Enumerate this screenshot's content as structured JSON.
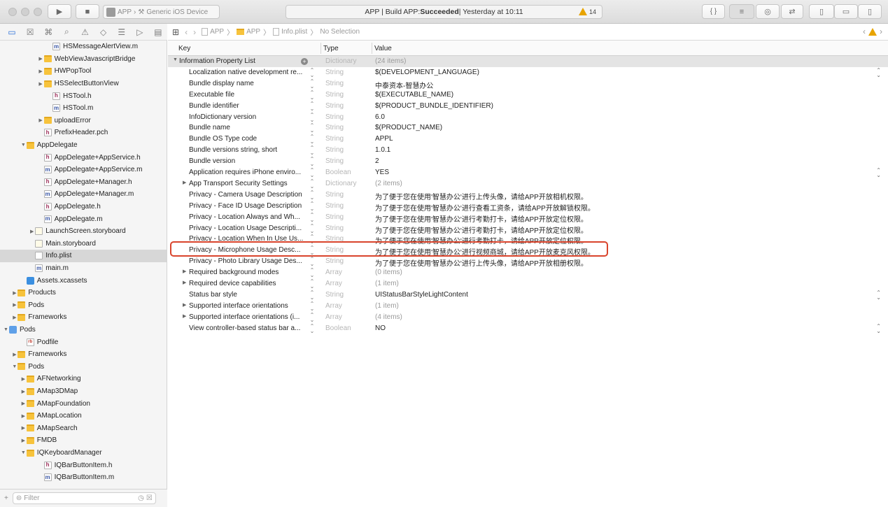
{
  "toolbar": {
    "scheme": {
      "project": "APP",
      "device": "Generic iOS Device"
    },
    "status": {
      "prefix": "APP | Build APP: ",
      "result": "Succeeded",
      "suffix": " | Yesterday at 10:11"
    },
    "warning_count": "14",
    "editor_mode_icons": [
      "{ }",
      "standard-editor-icon",
      "assistant-editor-icon",
      "version-editor-icon"
    ],
    "panel_icons": [
      "left-panel-icon",
      "bottom-panel-icon",
      "right-panel-icon"
    ]
  },
  "navigator": {
    "tabs": [
      "folder-icon",
      "source-control-icon",
      "hierarchy-icon",
      "search-icon",
      "warning-icon",
      "test-icon",
      "debug-icon",
      "breakpoint-icon",
      "report-icon"
    ],
    "items": [
      {
        "label": "HSMessageAlertView.m",
        "kind": "m",
        "depth": 5,
        "disclosure": ""
      },
      {
        "label": "WebViewJavascriptBridge",
        "kind": "folder",
        "depth": 4,
        "disclosure": "▶"
      },
      {
        "label": "HWPopTool",
        "kind": "folder",
        "depth": 4,
        "disclosure": "▶"
      },
      {
        "label": "HSSelectButtonView",
        "kind": "folder",
        "depth": 4,
        "disclosure": "▶"
      },
      {
        "label": "HSTool.h",
        "kind": "h",
        "depth": 5,
        "disclosure": ""
      },
      {
        "label": "HSTool.m",
        "kind": "m",
        "depth": 5,
        "disclosure": ""
      },
      {
        "label": "uploadError",
        "kind": "folder",
        "depth": 4,
        "disclosure": "▶"
      },
      {
        "label": "PrefixHeader.pch",
        "kind": "h",
        "depth": 4,
        "disclosure": ""
      },
      {
        "label": "AppDelegate",
        "kind": "folder",
        "depth": 2,
        "disclosure": "▼"
      },
      {
        "label": "AppDelegate+AppService.h",
        "kind": "h",
        "depth": 4,
        "disclosure": ""
      },
      {
        "label": "AppDelegate+AppService.m",
        "kind": "m",
        "depth": 4,
        "disclosure": ""
      },
      {
        "label": "AppDelegate+Manager.h",
        "kind": "h",
        "depth": 4,
        "disclosure": ""
      },
      {
        "label": "AppDelegate+Manager.m",
        "kind": "m",
        "depth": 4,
        "disclosure": ""
      },
      {
        "label": "AppDelegate.h",
        "kind": "h",
        "depth": 4,
        "disclosure": ""
      },
      {
        "label": "AppDelegate.m",
        "kind": "m",
        "depth": 4,
        "disclosure": ""
      },
      {
        "label": "LaunchScreen.storyboard",
        "kind": "sb",
        "depth": 3,
        "disclosure": "▶"
      },
      {
        "label": "Main.storyboard",
        "kind": "sb",
        "depth": 3,
        "disclosure": ""
      },
      {
        "label": "Info.plist",
        "kind": "plist",
        "depth": 3,
        "disclosure": "",
        "selected": true
      },
      {
        "label": "main.m",
        "kind": "m",
        "depth": 3,
        "disclosure": ""
      },
      {
        "label": "Assets.xcassets",
        "kind": "assets",
        "depth": 2,
        "disclosure": ""
      },
      {
        "label": "Products",
        "kind": "folder",
        "depth": 1,
        "disclosure": "▶"
      },
      {
        "label": "Pods",
        "kind": "folder",
        "depth": 1,
        "disclosure": "▶"
      },
      {
        "label": "Frameworks",
        "kind": "folder",
        "depth": 1,
        "disclosure": "▶"
      },
      {
        "label": "Pods",
        "kind": "pods",
        "depth": 0,
        "disclosure": "▼"
      },
      {
        "label": "Podfile",
        "kind": "rb",
        "depth": 2,
        "disclosure": ""
      },
      {
        "label": "Frameworks",
        "kind": "folder",
        "depth": 1,
        "disclosure": "▶"
      },
      {
        "label": "Pods",
        "kind": "folder",
        "depth": 1,
        "disclosure": "▼"
      },
      {
        "label": "AFNetworking",
        "kind": "folder",
        "depth": 2,
        "disclosure": "▶"
      },
      {
        "label": "AMap3DMap",
        "kind": "folder",
        "depth": 2,
        "disclosure": "▶"
      },
      {
        "label": "AMapFoundation",
        "kind": "folder",
        "depth": 2,
        "disclosure": "▶"
      },
      {
        "label": "AMapLocation",
        "kind": "folder",
        "depth": 2,
        "disclosure": "▶"
      },
      {
        "label": "AMapSearch",
        "kind": "folder",
        "depth": 2,
        "disclosure": "▶"
      },
      {
        "label": "FMDB",
        "kind": "folder",
        "depth": 2,
        "disclosure": "▶"
      },
      {
        "label": "IQKeyboardManager",
        "kind": "folder",
        "depth": 2,
        "disclosure": "▼"
      },
      {
        "label": "IQBarButtonItem.h",
        "kind": "h",
        "depth": 4,
        "disclosure": ""
      },
      {
        "label": "IQBarButtonItem.m",
        "kind": "m",
        "depth": 4,
        "disclosure": ""
      }
    ],
    "filter_placeholder": "Filter"
  },
  "jumpbar": {
    "crumbs": [
      "APP",
      "APP",
      "Info.plist",
      "No Selection"
    ]
  },
  "plist": {
    "columns": {
      "key": "Key",
      "type": "Type",
      "value": "Value"
    },
    "root": {
      "key": "Information Property List",
      "type": "Dictionary",
      "value": "(24 items)"
    },
    "rows": [
      {
        "key": "Localization native development re...",
        "type": "String",
        "value": "$(DEVELOPMENT_LANGUAGE)",
        "popup": true
      },
      {
        "key": "Bundle display name",
        "type": "String",
        "value": "中泰资本-智慧办公"
      },
      {
        "key": "Executable file",
        "type": "String",
        "value": "$(EXECUTABLE_NAME)"
      },
      {
        "key": "Bundle identifier",
        "type": "String",
        "value": "$(PRODUCT_BUNDLE_IDENTIFIER)"
      },
      {
        "key": "InfoDictionary version",
        "type": "String",
        "value": "6.0"
      },
      {
        "key": "Bundle name",
        "type": "String",
        "value": "$(PRODUCT_NAME)"
      },
      {
        "key": "Bundle OS Type code",
        "type": "String",
        "value": "APPL"
      },
      {
        "key": "Bundle versions string, short",
        "type": "String",
        "value": "1.0.1"
      },
      {
        "key": "Bundle version",
        "type": "String",
        "value": "2"
      },
      {
        "key": "Application requires iPhone enviro...",
        "type": "Boolean",
        "value": "YES",
        "popup": true
      },
      {
        "key": "App Transport Security Settings",
        "type": "Dictionary",
        "value": "(2 items)",
        "expandable": true
      },
      {
        "key": "Privacy - Camera Usage Description",
        "type": "String",
        "value": "为了便于您在使用'智慧办公'进行上传头像，请给APP开放相机权限。"
      },
      {
        "key": "Privacy - Face ID Usage Description",
        "type": "String",
        "value": "为了便于您在使用'智慧办公'进行查看工资条，请给APP开放解锁权限。"
      },
      {
        "key": "Privacy - Location Always and Wh...",
        "type": "String",
        "value": "为了便于您在使用'智慧办公'进行考勤打卡，请给APP开放定位权限。"
      },
      {
        "key": "Privacy - Location Usage Descripti...",
        "type": "String",
        "value": "为了便于您在使用'智慧办公'进行考勤打卡，请给APP开放定位权限。"
      },
      {
        "key": "Privacy - Location When In Use Us...",
        "type": "String",
        "value": "为了便于您在使用'智慧办公'进行考勤打卡，请给APP开放定位权限。"
      },
      {
        "key": "Privacy - Microphone Usage Desc...",
        "type": "String",
        "value": "为了便于您在使用'智慧办公'进行视频商城，请给APP开放麦克风权限。"
      },
      {
        "key": "Privacy - Photo Library Usage Des...",
        "type": "String",
        "value": "为了便于您在使用'智慧办公'进行上传头像，请给APP开放相册权限。"
      },
      {
        "key": "Required background modes",
        "type": "Array",
        "value": "(0 items)",
        "expandable": true
      },
      {
        "key": "Required device capabilities",
        "type": "Array",
        "value": "(1 item)",
        "expandable": true
      },
      {
        "key": "Status bar style",
        "type": "String",
        "value": "UIStatusBarStyleLightContent",
        "popup": true
      },
      {
        "key": "Supported interface orientations",
        "type": "Array",
        "value": "(1 item)",
        "expandable": true
      },
      {
        "key": "Supported interface orientations (i...",
        "type": "Array",
        "value": "(4 items)",
        "expandable": true
      },
      {
        "key": "View controller-based status bar a...",
        "type": "Boolean",
        "value": "NO",
        "popup": true
      }
    ]
  },
  "colors": {
    "accent": "#2a6fd8",
    "highlight_box": "#d9442c",
    "warning": "#e8a400"
  }
}
